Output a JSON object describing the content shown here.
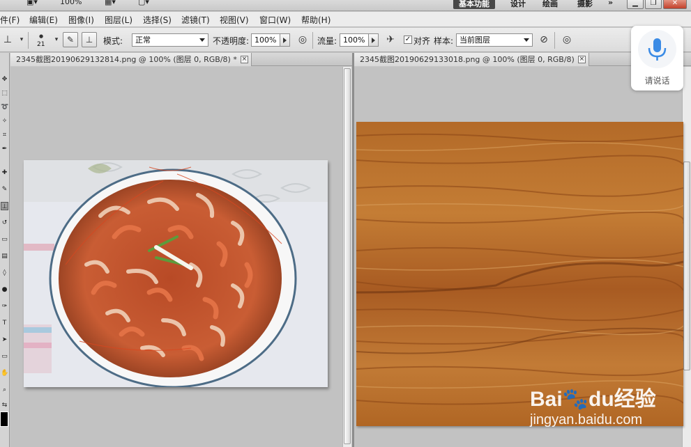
{
  "appbar": {
    "zoom": "100%",
    "workspaces": [
      "基本功能",
      "设计",
      "绘画",
      "摄影"
    ],
    "more": "»"
  },
  "menu": [
    "件(F)",
    "编辑(E)",
    "图像(I)",
    "图层(L)",
    "选择(S)",
    "滤镜(T)",
    "视图(V)",
    "窗口(W)",
    "帮助(H)"
  ],
  "options": {
    "brush_size": "21",
    "mode_label": "模式:",
    "mode_value": "正常",
    "opacity_label": "不透明度:",
    "opacity_value": "100%",
    "flow_label": "流量:",
    "flow_value": "100%",
    "align_label": "对齐",
    "align_checked": true,
    "sample_label": "样本:",
    "sample_value": "当前图层"
  },
  "documents": [
    {
      "title": "2345截图20190629132814.png @ 100% (图层 0, RGB/8) *",
      "close": "×",
      "image": "shrimp-bowl-photo"
    },
    {
      "title": "2345截图20190629133018.png @ 100% (图层 0, RGB/8)",
      "close": "×",
      "image": "wood-texture-photo"
    }
  ],
  "voice": {
    "label": "请说话"
  },
  "watermark": {
    "logo": "Bai🐾du经验",
    "url": "jingyan.baidu.com"
  },
  "colors": {
    "accent": "#474747",
    "mic": "#3b8be5",
    "chrome": "#ececec"
  }
}
